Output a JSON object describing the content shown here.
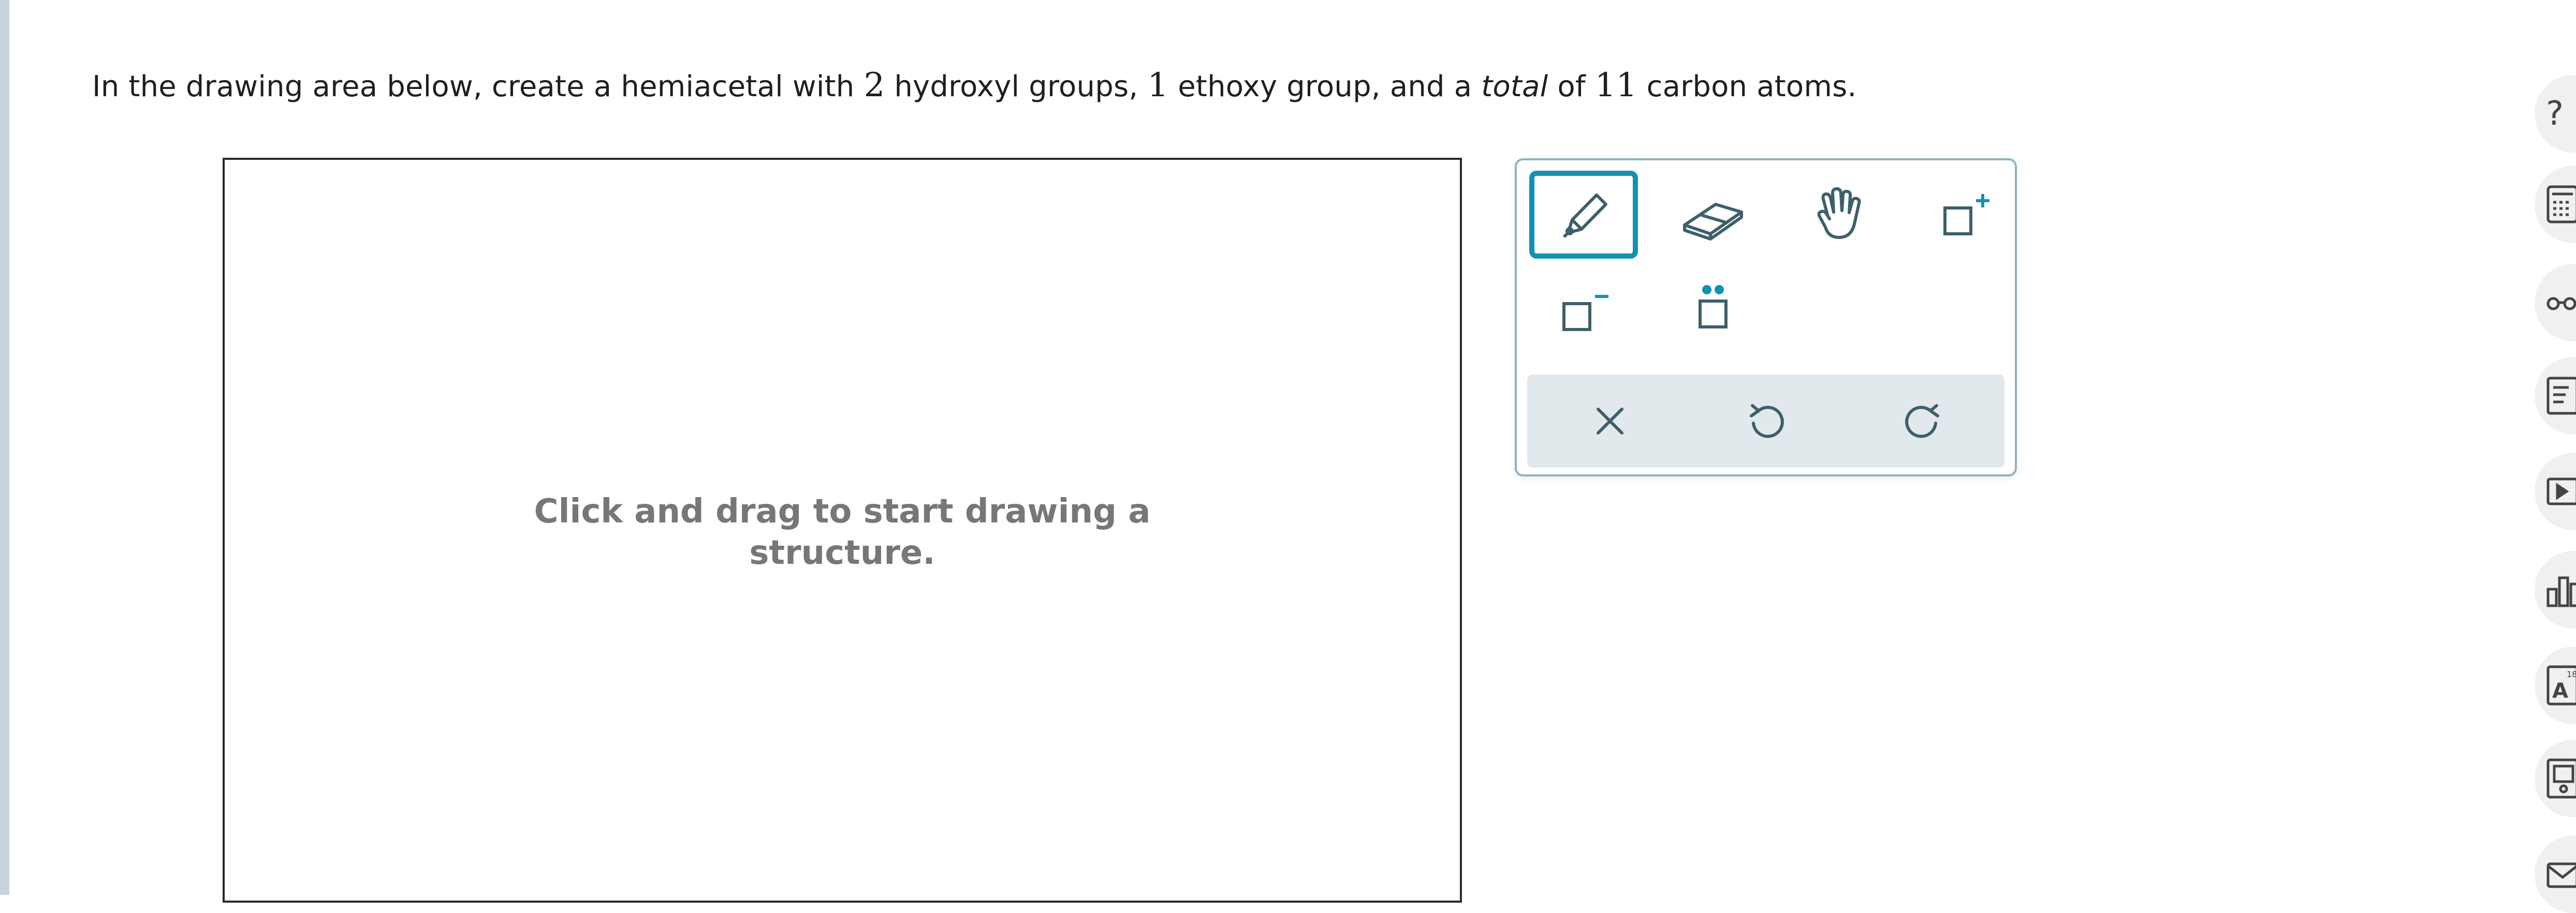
{
  "question": {
    "prefix": "In the drawing area below, create a hemiacetal with ",
    "hydroxyl_count": "2",
    "mid1": " hydroxyl groups, ",
    "ethoxy_count": "1",
    "mid2": " ethoxy group, and a ",
    "emph": "total",
    "mid3": " of ",
    "carbon_count": "11",
    "suffix": " carbon atoms."
  },
  "canvas": {
    "hint": "Click and drag to start drawing a structure."
  },
  "toolbar": {
    "tools": [
      {
        "name": "pencil-icon",
        "active": true
      },
      {
        "name": "eraser-icon",
        "active": false
      },
      {
        "name": "hand-icon",
        "active": false
      },
      {
        "name": "add-charge-icon",
        "active": false
      },
      {
        "name": "remove-charge-icon",
        "active": false
      },
      {
        "name": "lone-pair-icon",
        "active": false
      }
    ],
    "actions": [
      "clear-icon",
      "undo-icon",
      "redo-icon"
    ]
  },
  "sidebar": {
    "items": [
      "help-icon",
      "calculator-icon",
      "glasses-icon",
      "notes-icon",
      "video-icon",
      "chart-icon",
      "periodic-table-icon",
      "textbook-icon",
      "mail-icon"
    ],
    "help_glyph": "?",
    "periodic_label": "A",
    "periodic_number": "18"
  },
  "colors": {
    "accent": "#1293ad",
    "icon": "#3e5f6b",
    "hint": "#777777"
  }
}
